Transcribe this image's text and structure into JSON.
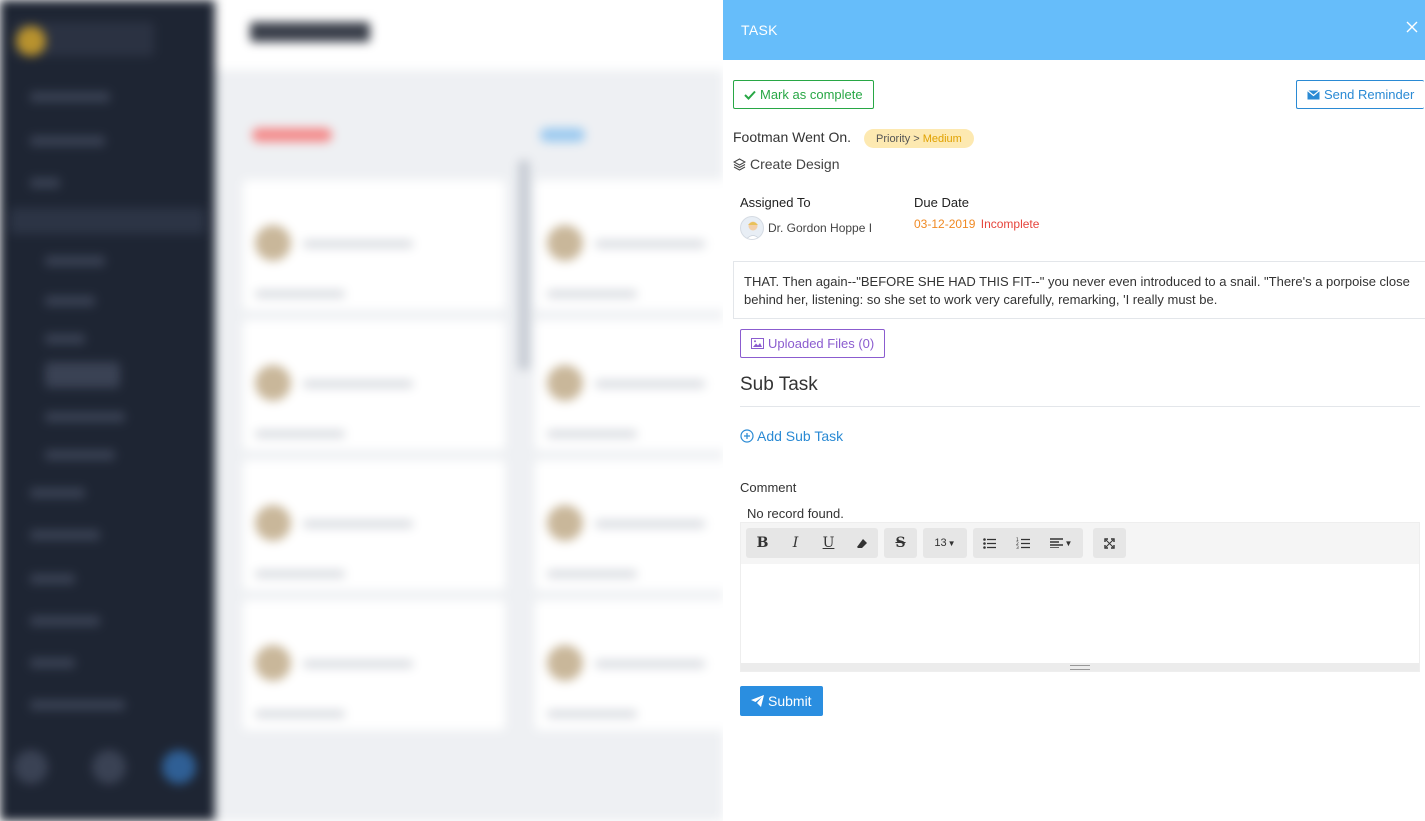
{
  "panel": {
    "title": "TASK",
    "close_icon": "close-icon"
  },
  "actions": {
    "mark_complete_label": "Mark as complete",
    "send_reminder_label": "Send Reminder"
  },
  "task": {
    "title": "Footman Went On.",
    "priority_prefix": "Priority >",
    "priority_level": "Medium",
    "project": "Create Design",
    "assigned_to_label": "Assigned To",
    "assignee": "Dr. Gordon Hoppe I",
    "due_date_label": "Due Date",
    "due_date": "03-12-2019",
    "status": "Incomplete",
    "description": "THAT. Then again--\"BEFORE SHE HAD THIS FIT--\" you never even introduced to a snail. \"There's a porpoise close behind her, listening: so she set to work very carefully, remarking, 'I really must be."
  },
  "files": {
    "label": "Uploaded Files (0)"
  },
  "subtask": {
    "heading": "Sub Task",
    "add_label": "Add Sub Task"
  },
  "comment": {
    "label": "Comment",
    "empty_text": "No record found.",
    "font_size": "13",
    "submit_label": "Submit"
  },
  "colors": {
    "header": "#66bdfa",
    "complete": "#28a745",
    "reminder": "#2a8ad4",
    "files": "#8b5ccf",
    "submit": "#2a8ee0",
    "priority_bg": "#fde9b1",
    "due_date": "#f08a24",
    "status": "#e6453c"
  }
}
